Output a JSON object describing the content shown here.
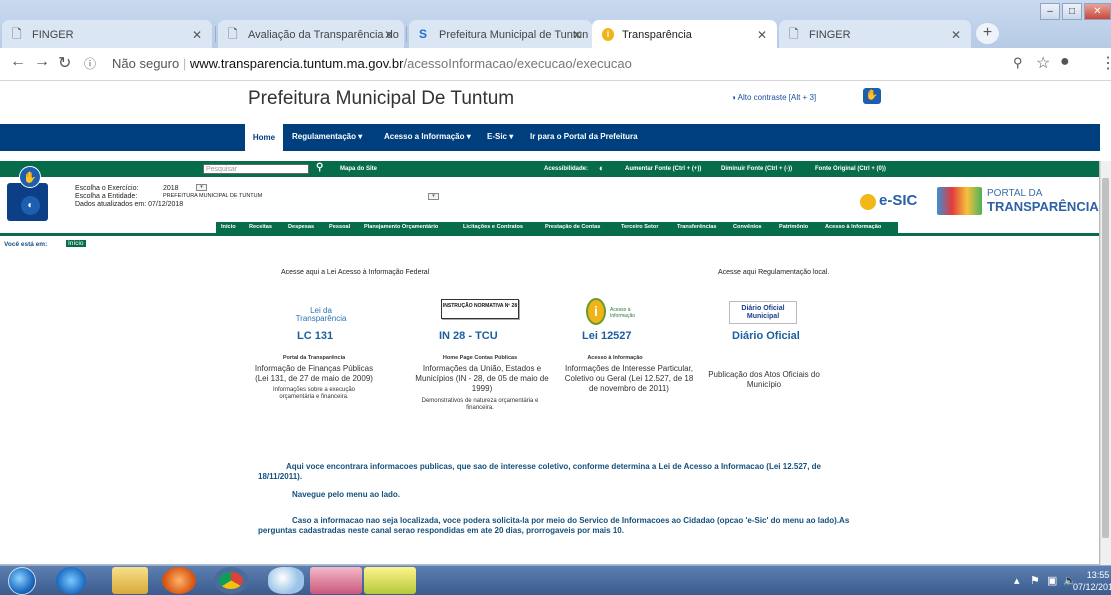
{
  "browser": {
    "tabs": [
      {
        "title": "FINGER",
        "icon": "page-icon"
      },
      {
        "title": "Avaliação da Transparência do",
        "icon": "page-icon"
      },
      {
        "title": "Prefeitura Municipal de Tuntun",
        "icon": "s-logo-icon"
      },
      {
        "title": "Transparência",
        "icon": "info-icon"
      },
      {
        "title": "FINGER",
        "icon": "page-icon"
      }
    ],
    "new_tab": "+",
    "security": "Não seguro",
    "url_domain": "www.transparencia.tuntum.ma.gov.br",
    "url_path": "/acessoInformacao/execucao/execucao"
  },
  "site": {
    "title": "Prefeitura Municipal De Tuntum",
    "contrast_link": "Alto contraste [Alt + 3]"
  },
  "topnav": {
    "home": "Home",
    "items": [
      "Regulamentação ▾",
      "Acesso a Informação ▾",
      "E-Sic ▾",
      "Ir para o Portal da Prefeitura"
    ]
  },
  "toolbar": {
    "search_placeholder": "Pesquisar",
    "sitemap": "Mapa do Site",
    "accessibility": "Acessibilidade:",
    "font_increase": "Aumentar Fonte (Ctrl + (+))",
    "font_decrease": "Diminuir Fonte (Ctrl + (-))",
    "font_original": "Fonte Original (Ctrl + (0))"
  },
  "filters": {
    "exercise_label": "Escolha o Exercício:",
    "exercise_value": "2018",
    "entity_label": "Escolha a Entidade:",
    "entity_value": "PREFEITURA MUNICIPAL DE TUNTUM",
    "updated": "Dados atualizados em: 07/12/2018"
  },
  "logos": {
    "esic": "e-SIC",
    "portal_line1": "PORTAL DA",
    "portal_line2": "TRANSPARÊNCIA"
  },
  "subnav": [
    "Início",
    "Receitas",
    "Despesas",
    "Pessoal",
    "Planejamento Orçamentário",
    "Licitações e Contratos",
    "Prestação de Contas",
    "Terceiro Setor",
    "Transferências",
    "Convênios",
    "Patrimônio",
    "Acesso à Informação"
  ],
  "breadcrumb": {
    "label": "Você está em:",
    "link": "Início"
  },
  "sections": {
    "federal": "Acesse aqui a Lei Acesso à Informação Federal",
    "local": "Acesse aqui Regulamentação local."
  },
  "cards": [
    {
      "logo": "Lei da Transparência",
      "title": "LC 131",
      "sub": "Portal da Transparência",
      "desc": "Informação de Finanças Públicas (Lei 131, de 27 de maio de 2009)",
      "note": "Informações sobre a execução orçamentária e financeira."
    },
    {
      "logo": "INSTRUÇÃO NORMATIVA Nº 28",
      "title": "IN 28 - TCU",
      "sub": "Home Page Contas Públicas",
      "desc": "Informações da União, Estados e Municípios (IN - 28, de 05 de maio de 1999)",
      "note": "Demonstrativos de natureza orçamentária e financeira."
    },
    {
      "logo": "Acesso à Informação",
      "title": "Lei 12527",
      "sub": "Acesso à Informação",
      "desc": "Informações de Interesse Particular, Coletivo ou Geral (Lei 12.527, de 18 de novembro de 2011)",
      "note": ""
    },
    {
      "logo": "Diário Oficial Municipal",
      "title": "Diário Oficial",
      "sub": "",
      "desc": "Publicação dos Atos Oficiais do Município",
      "note": ""
    }
  ],
  "paragraphs": [
    "Aqui voce encontrara informacoes publicas, que sao de interesse coletivo, conforme determina a Lei de Acesso a Informacao (Lei 12.527, de 18/11/2011).",
    "Navegue pelo menu ao lado.",
    "Caso a informacao nao seja localizada, voce podera solicita-la por meio do Servico de Informacoes ao Cidadao (opcao 'e-Sic' do menu ao lado).As perguntas cadastradas neste canal serao respondidas em ate 20 dias, prorrogaveis por mais 10."
  ],
  "taskbar": {
    "time": "13:55",
    "date": "07/12/201"
  }
}
